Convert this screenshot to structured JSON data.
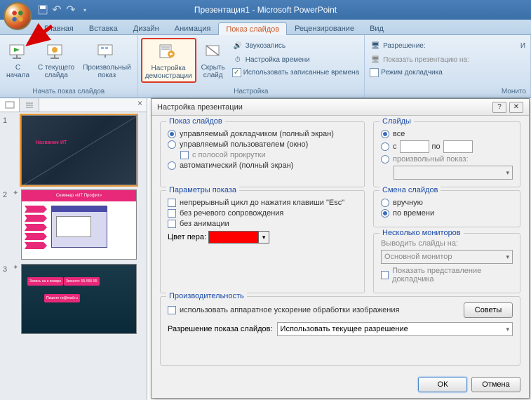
{
  "app": {
    "title": "Презентация1 - Microsoft PowerPoint"
  },
  "tabs": {
    "home": "Главная",
    "insert": "Вставка",
    "design": "Дизайн",
    "animation": "Анимация",
    "slideshow": "Показ слайдов",
    "review": "Рецензирование",
    "view": "Вид"
  },
  "ribbon": {
    "group_start": "Начать показ слайдов",
    "group_setup": "Настройка",
    "group_monitors": "Монито",
    "from_start": "С\nначала",
    "from_current": "С текущего\nслайда",
    "custom_show": "Произвольный\nпоказ",
    "setup_show": "Настройка\nдемонстрации",
    "hide_slide": "Скрыть\nслайд",
    "record_narration": "Звукозапись",
    "rehearse": "Настройка времени",
    "use_timings": "Использовать записанные времена",
    "resolution": "Разрешение:",
    "show_on": "Показать презентацию на:",
    "presenter_view": "Режим докладчика",
    "and_label": "И"
  },
  "thumbs": {
    "slide1_title": "Название ИТ",
    "slide2_header": "Семинар «ИТ Профит»",
    "slide3_box1": "Запись на\nв январе",
    "slide3_box2": "Звоните:\n55-555-55",
    "slide3_box3": "Пишите\nтр@mail.ru"
  },
  "dialog": {
    "title": "Настройка презентации",
    "section_show_type": "Показ слайдов",
    "radio_speaker": "управляемый докладчиком (полный экран)",
    "radio_individual": "управляемый пользователем (окно)",
    "check_scrollbar": "с полосой прокрутки",
    "radio_kiosk": "автоматический (полный экран)",
    "section_slides": "Слайды",
    "radio_all": "все",
    "radio_from": "с",
    "label_to": "по",
    "radio_custom": "произвольный показ:",
    "section_show_options": "Параметры показа",
    "check_loop": "непрерывный цикл до нажатия клавиши \"Esc\"",
    "check_no_narration": "без речевого сопровождения",
    "check_no_animation": "без анимации",
    "pen_color": "Цвет пера:",
    "section_advance": "Смена слайдов",
    "radio_manual": "вручную",
    "radio_timings": "по времени",
    "section_monitors": "Несколько мониторов",
    "monitor_label": "Выводить слайды на:",
    "monitor_value": "Основной монитор",
    "check_presenter": "Показать представление докладчика",
    "section_perf": "Производительность",
    "check_hw": "использовать аппаратное ускорение обработки изображения",
    "tips": "Советы",
    "resolution_label": "Разрешение показа слайдов:",
    "resolution_value": "Использовать текущее разрешение",
    "ok": "ОК",
    "cancel": "Отмена"
  }
}
